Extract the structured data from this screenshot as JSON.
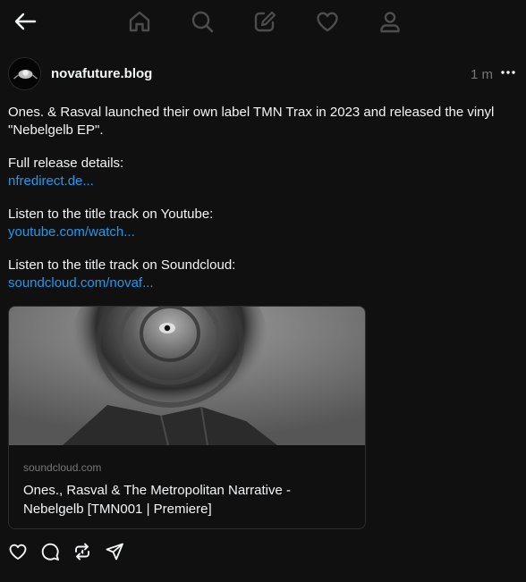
{
  "topbar": {
    "back": {
      "icon": "arrow-left-icon"
    },
    "nav": [
      {
        "icon": "home-icon"
      },
      {
        "icon": "search-icon"
      },
      {
        "icon": "compose-icon"
      },
      {
        "icon": "heart-icon"
      },
      {
        "icon": "profile-icon"
      }
    ]
  },
  "post": {
    "username": "novafuture.blog",
    "time": "1 m",
    "text": "Ones. & Rasval launched their own label TMN Trax in 2023 and released the vinyl \"Nebelgelb EP\".",
    "sections": [
      {
        "label": "Full release details:",
        "link": "nfredirect.de..."
      },
      {
        "label": "Listen to the title track on Youtube:",
        "link": "youtube.com/watch..."
      },
      {
        "label": "Listen to the title track on Soundcloud:",
        "link": "soundcloud.com/novaf..."
      }
    ],
    "card": {
      "domain": "soundcloud.com",
      "title": "Ones., Rasval & The Metropolitan Narrative - Nebelgelb [TMN001 | Premiere]"
    },
    "actions": [
      "heart-icon",
      "comment-icon",
      "repost-icon",
      "share-icon"
    ]
  },
  "colors": {
    "background": "#101010",
    "text": "#f3f5f7",
    "link": "#1d9bf0",
    "muted": "#777777"
  }
}
